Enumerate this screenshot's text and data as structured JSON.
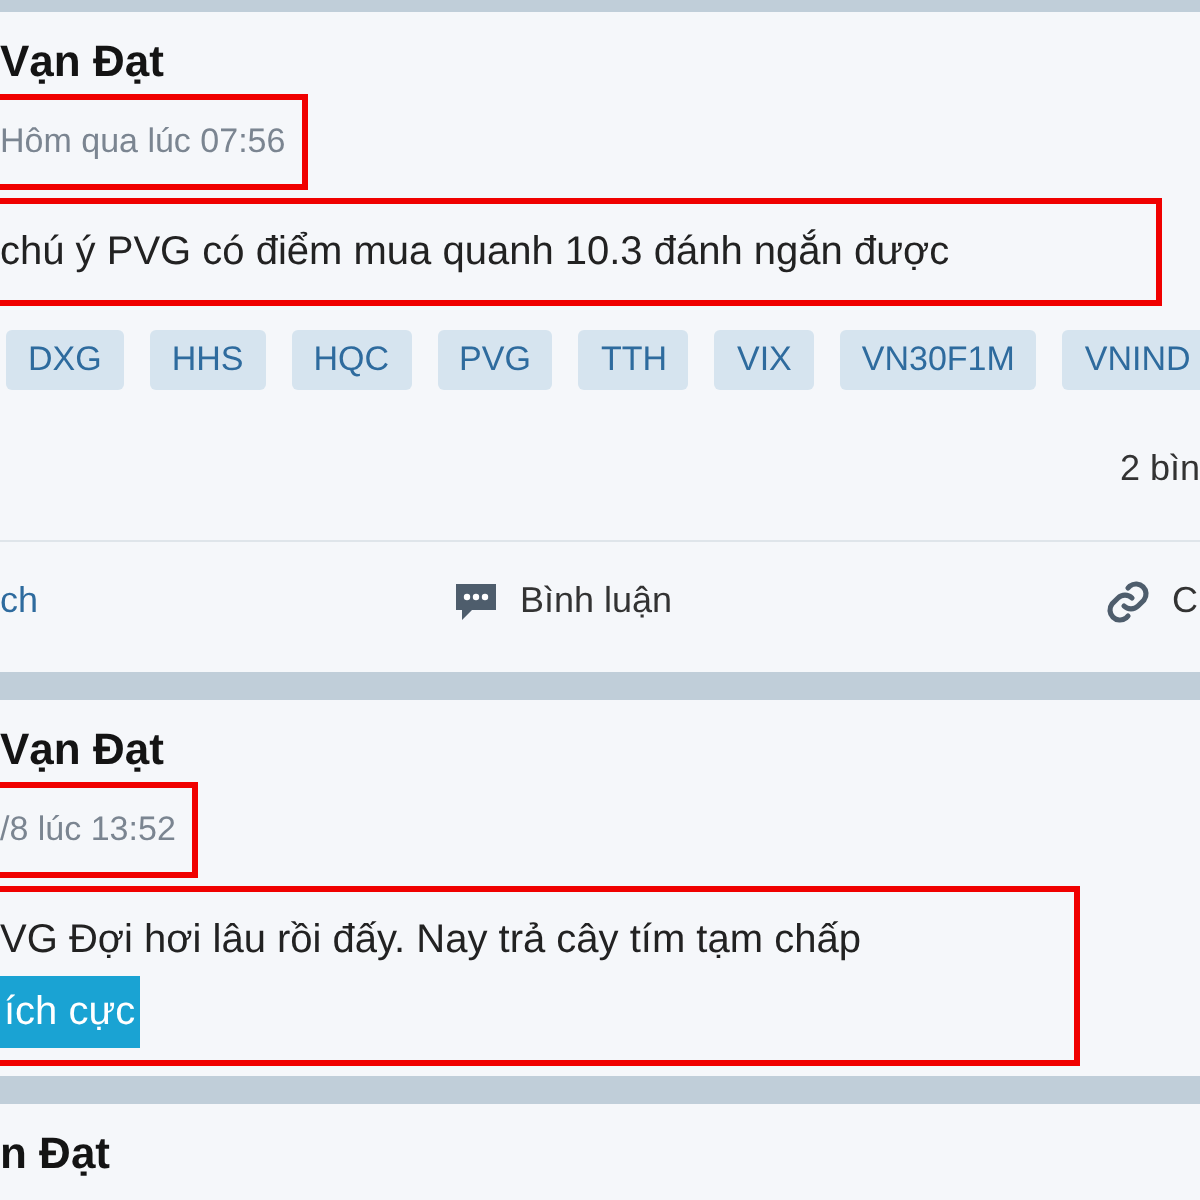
{
  "posts": [
    {
      "author": "Vạn Đạt",
      "time": "Hôm qua lúc 07:56",
      "time_highlighted": true,
      "body": [
        {
          "text": "chú ý PVG có điểm mua quanh 10.3 đánh ngắn được",
          "kind": "plain"
        }
      ],
      "body_highlighted": true,
      "tags": [
        "DXG",
        "HHS",
        "HQC",
        "PVG",
        "TTH",
        "VIX",
        "VN30F1M",
        "VNIND"
      ],
      "comment_count": "2 bìn",
      "actions": [
        {
          "kind": "link",
          "label": "ch"
        },
        {
          "kind": "comment",
          "label": "Bình luận"
        },
        {
          "kind": "share",
          "label": "C"
        }
      ]
    },
    {
      "author": "Vạn Đạt",
      "time": "/8 lúc 13:52",
      "time_highlighted": true,
      "body": [
        {
          "text": "VG Đợi hơi lâu rồi đấy. Nay trả cây tím tạm chấp",
          "kind": "plain"
        },
        {
          "text": "ích cực",
          "kind": "sentiment"
        }
      ],
      "body_highlighted": true
    },
    {
      "author": "n Đạt"
    }
  ]
}
